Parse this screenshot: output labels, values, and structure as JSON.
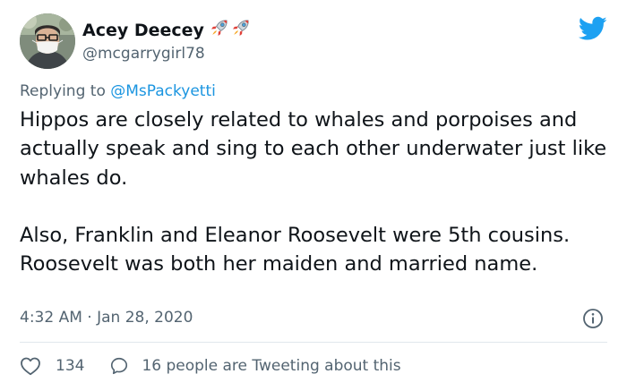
{
  "author": {
    "name": "Acey Deecey",
    "name_emoji": [
      "rocket",
      "rocket"
    ],
    "handle": "@mcgarrygirl78"
  },
  "reply": {
    "prefix": "Replying to",
    "mention": "@MsPackyetti"
  },
  "tweet": {
    "paragraphs": [
      "Hippos are closely related to whales and porpoises and actually speak and sing to each other underwater just like whales do.",
      "Also, Franklin and Eleanor Roosevelt were 5th cousins. Roosevelt was both her maiden and married name."
    ],
    "timestamp": "4:32 AM · Jan 28, 2020"
  },
  "stats": {
    "likes": "134",
    "talking": "16 people are Tweeting about this"
  },
  "icons": [
    "twitter-bird-icon",
    "info-icon",
    "heart-icon",
    "comment-bubble-icon",
    "rocket-icon"
  ],
  "colors": {
    "brand_blue": "#1da1f2",
    "link_blue": "#1b95e0",
    "secondary_text": "#536471",
    "divider": "#e1e8ed"
  }
}
